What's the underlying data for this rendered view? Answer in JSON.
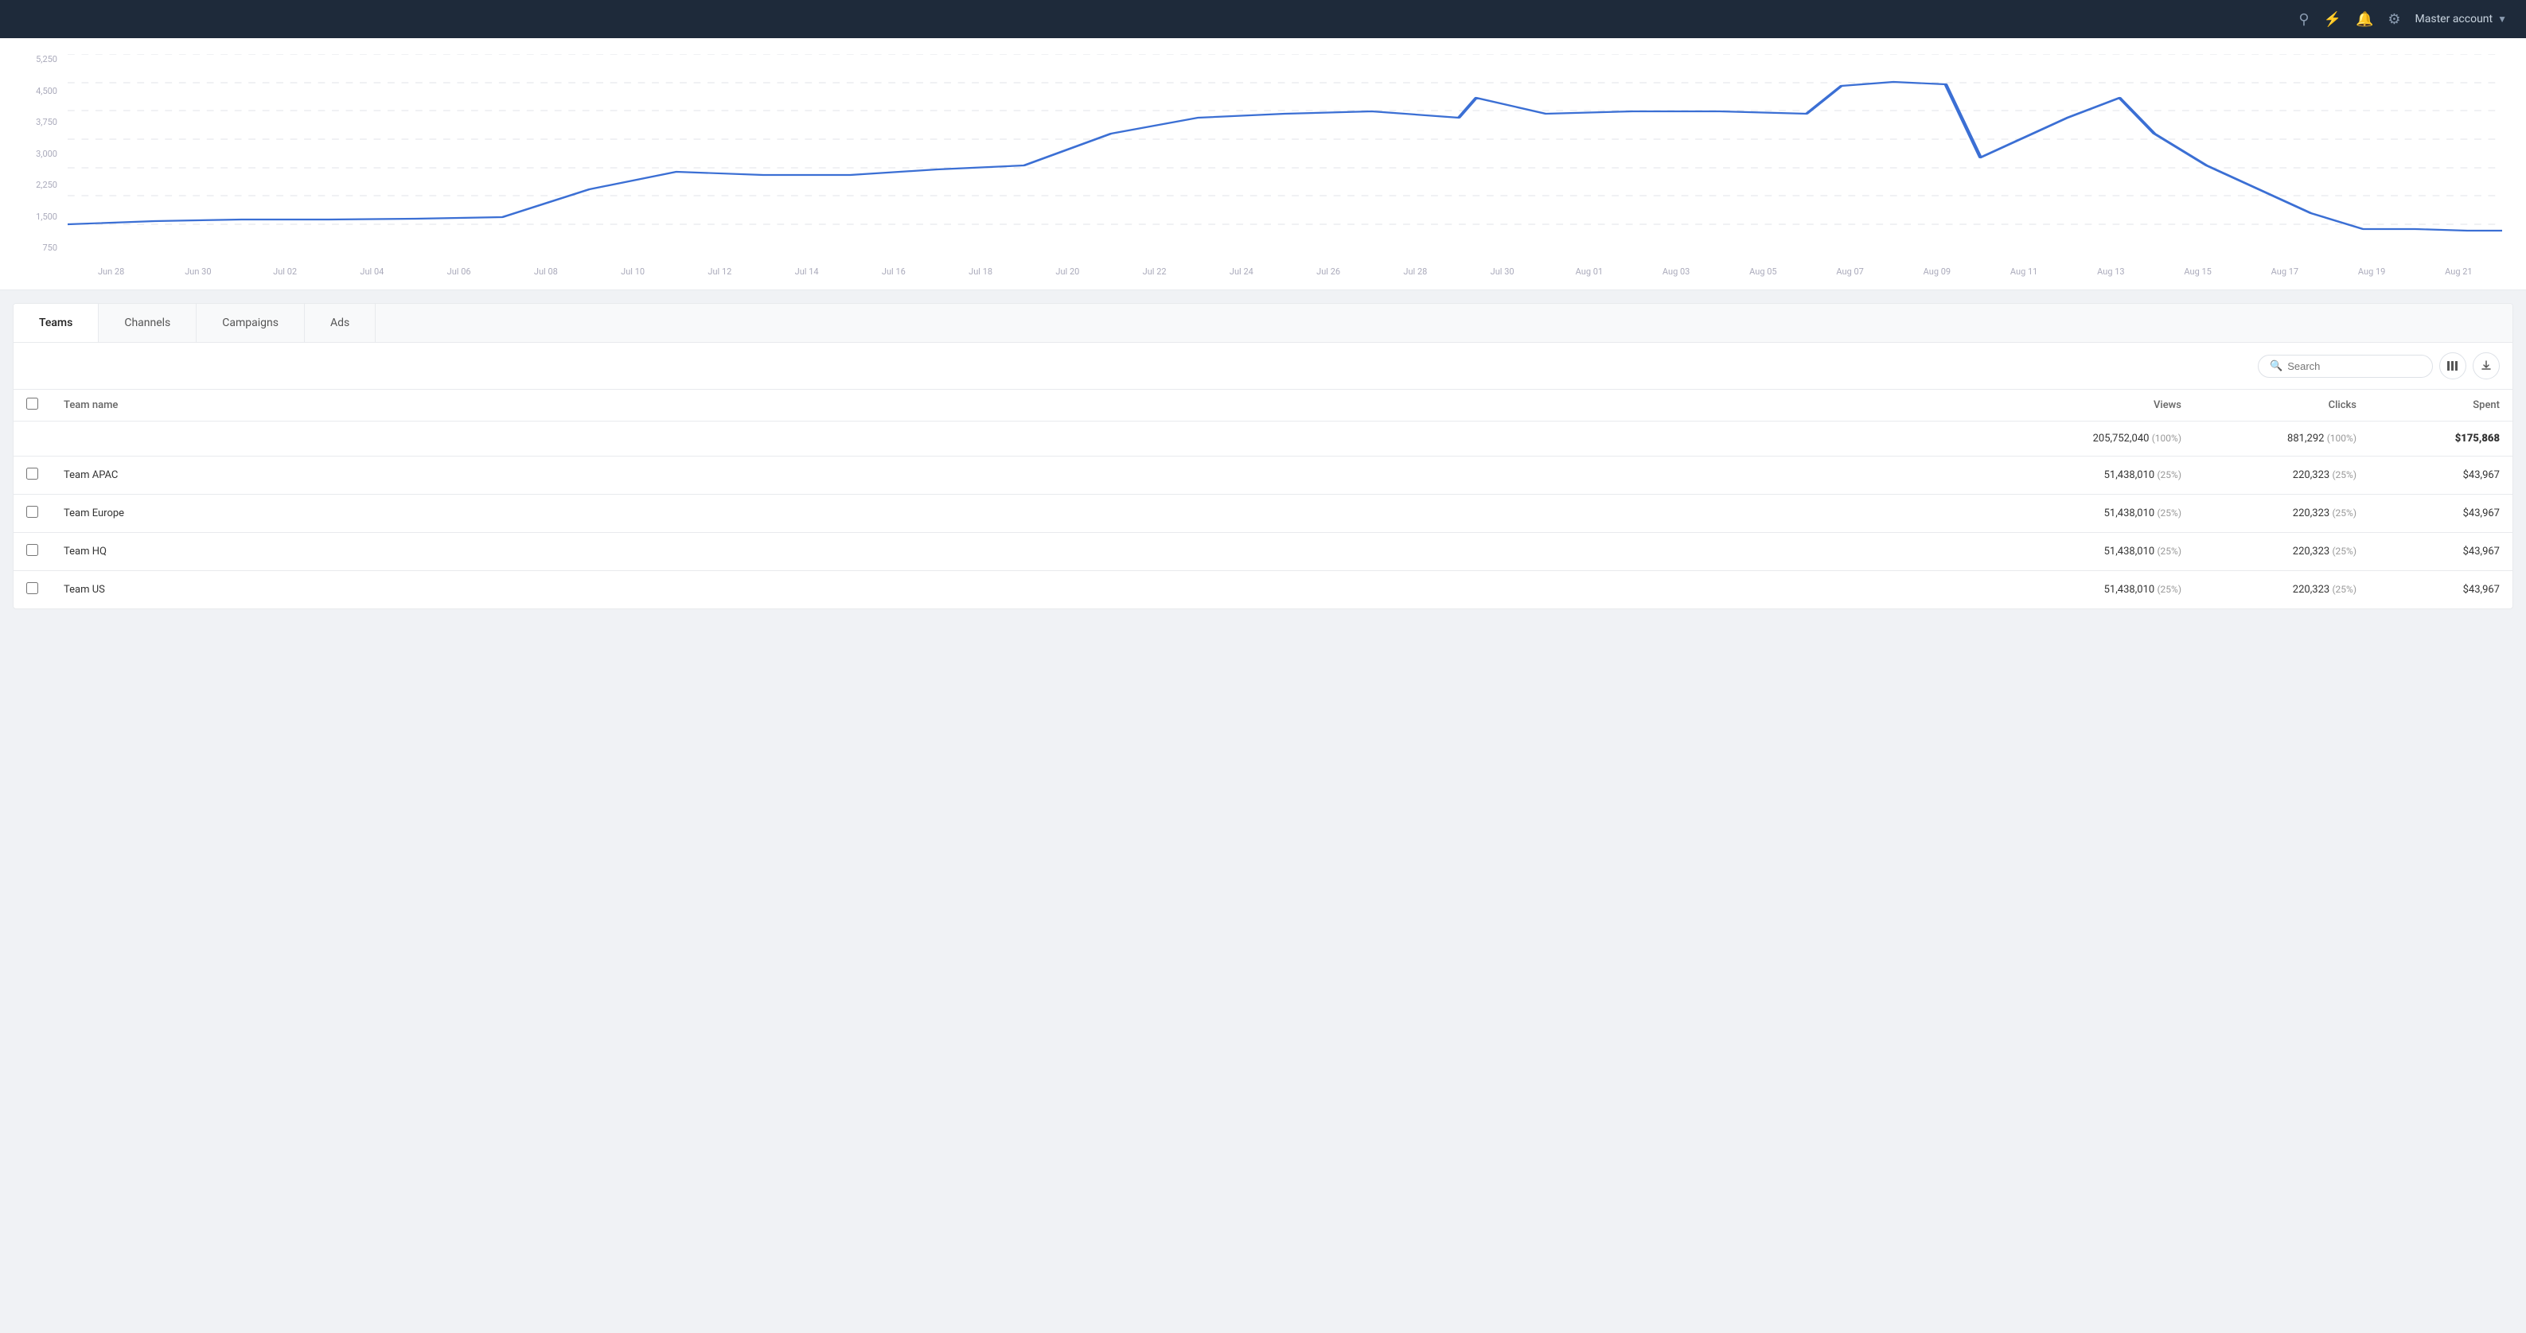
{
  "topnav": {
    "account_label": "Master account",
    "icons": [
      "search",
      "bolt",
      "bell",
      "gear"
    ]
  },
  "chart": {
    "y_labels": [
      "750",
      "1,500",
      "2,250",
      "3,000",
      "3,750",
      "4,500",
      "5,250"
    ],
    "x_labels": [
      "Jun 28",
      "Jun 30",
      "Jul 02",
      "Jul 04",
      "Jul 06",
      "Jul 08",
      "Jul 10",
      "Jul 12",
      "Jul 14",
      "Jul 16",
      "Jul 18",
      "Jul 20",
      "Jul 22",
      "Jul 24",
      "Jul 26",
      "Jul 28",
      "Jul 30",
      "Aug 01",
      "Aug 03",
      "Aug 05",
      "Aug 07",
      "Aug 09",
      "Aug 11",
      "Aug 13",
      "Aug 15",
      "Aug 17",
      "Aug 19",
      "Aug 21"
    ]
  },
  "tabs": [
    {
      "label": "Teams",
      "active": true
    },
    {
      "label": "Channels",
      "active": false
    },
    {
      "label": "Campaigns",
      "active": false
    },
    {
      "label": "Ads",
      "active": false
    }
  ],
  "toolbar": {
    "search_placeholder": "Search"
  },
  "table": {
    "headers": {
      "checkbox": "",
      "team_name": "Team name",
      "views": "Views",
      "clicks": "Clicks",
      "spent": "Spent"
    },
    "totals": {
      "views": "205,752,040",
      "views_pct": "(100%)",
      "clicks": "881,292",
      "clicks_pct": "(100%)",
      "spent": "$175,868"
    },
    "rows": [
      {
        "name": "Team APAC",
        "views": "51,438,010",
        "views_pct": "(25%)",
        "clicks": "220,323",
        "clicks_pct": "(25%)",
        "spent": "$43,967"
      },
      {
        "name": "Team Europe",
        "views": "51,438,010",
        "views_pct": "(25%)",
        "clicks": "220,323",
        "clicks_pct": "(25%)",
        "spent": "$43,967"
      },
      {
        "name": "Team HQ",
        "views": "51,438,010",
        "views_pct": "(25%)",
        "clicks": "220,323",
        "clicks_pct": "(25%)",
        "spent": "$43,967"
      },
      {
        "name": "Team US",
        "views": "51,438,010",
        "views_pct": "(25%)",
        "clicks": "220,323",
        "clicks_pct": "(25%)",
        "spent": "$43,967"
      }
    ]
  }
}
